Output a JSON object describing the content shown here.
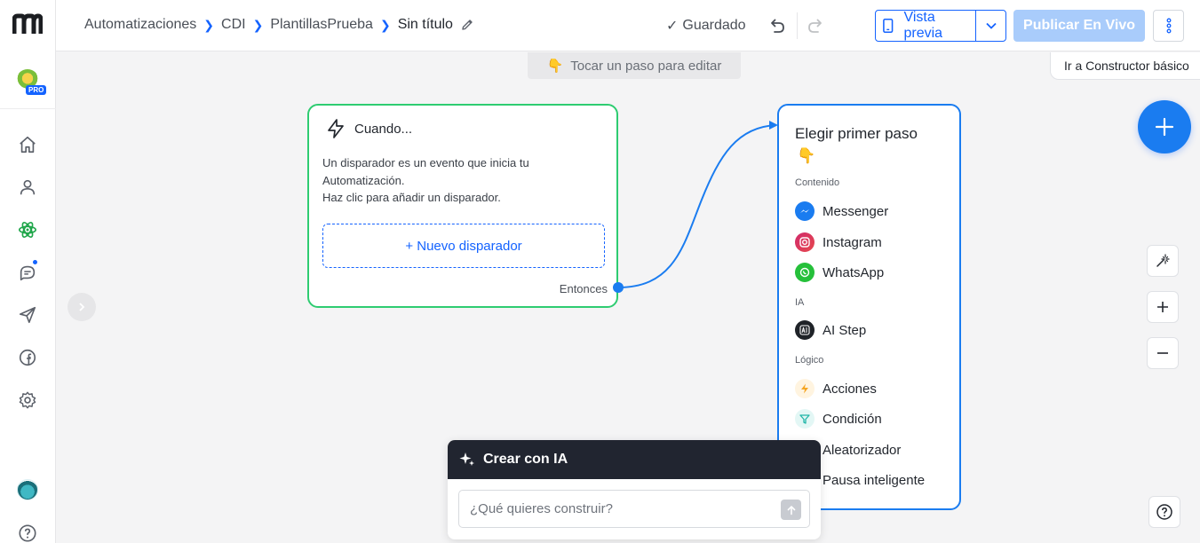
{
  "breadcrumb": {
    "items": [
      "Automatizaciones",
      "CDI",
      "PlantillasPrueba"
    ],
    "current": "Sin título"
  },
  "status": {
    "saved": "Guardado"
  },
  "toolbar": {
    "preview_label": "Vista previa",
    "publish_label": "Publicar En Vivo",
    "basic_builder": "Ir a Constructor básico"
  },
  "sidebar": {
    "pro_badge": "PRO"
  },
  "canvas": {
    "hint": "Tocar un paso para editar",
    "hint_emoji": "👇"
  },
  "trigger": {
    "title": "Cuando...",
    "description_line1": "Un disparador es un evento que inicia tu Automatización.",
    "description_line2": "Haz clic para añadir un disparador.",
    "new_trigger": "+ Nuevo disparador",
    "then": "Entonces"
  },
  "first_step": {
    "title": "Elegir primer paso",
    "emoji": "👇",
    "sections": {
      "content": "Contenido",
      "ai": "IA",
      "logic": "Lógico"
    },
    "content_items": [
      "Messenger",
      "Instagram",
      "WhatsApp"
    ],
    "ai_items": [
      "AI Step"
    ],
    "logic_items": [
      "Acciones",
      "Condición",
      "Aleatorizador",
      "Pausa inteligente"
    ]
  },
  "ai_panel": {
    "title": "Crear con IA",
    "placeholder": "¿Qué quieres construir?"
  },
  "colors": {
    "accent": "#1463ff",
    "trigger_border": "#2ecc71",
    "step_border": "#1a7cf0",
    "highlight": "#f5f500",
    "ai_header": "#212530"
  }
}
